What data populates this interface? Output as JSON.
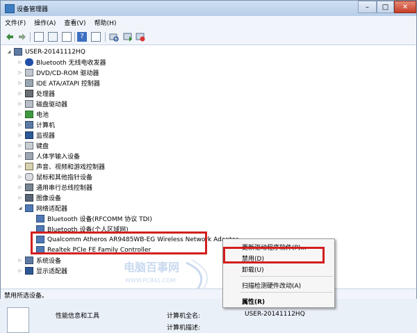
{
  "window": {
    "title": "设备管理器",
    "min": "–",
    "max": "□",
    "close": "✕"
  },
  "menu": [
    "文件(F)",
    "操作(A)",
    "查看(V)",
    "帮助(H)"
  ],
  "tree": {
    "root": "USER-20141112HQ",
    "categories": [
      "Bluetooth 无线电收发器",
      "DVD/CD-ROM 驱动器",
      "IDE ATA/ATAPI 控制器",
      "处理器",
      "磁盘驱动器",
      "电池",
      "计算机",
      "监视器",
      "键盘",
      "人体学输入设备",
      "声音、视频和游戏控制器",
      "鼠标和其他指针设备",
      "通用串行总线控制器",
      "图像设备",
      "网络适配器"
    ],
    "network_children": [
      "Bluetooth 设备(RFCOMM 协议 TDI)",
      "Bluetooth 设备(个人区域网)",
      "Qualcomm Atheros AR9485WB-EG Wireless Network Adapter",
      "Realtek PCIe FE Family Controller"
    ],
    "after": [
      "系统设备",
      "显示适配器"
    ]
  },
  "context_menu": [
    "更新驱动程序软件(P)...",
    "禁用(D)",
    "卸载(U)",
    "扫描检测硬件改动(A)",
    "属性(R)"
  ],
  "status": "禁用所选设备。",
  "bottom": {
    "perf": "性能信息和工具",
    "fullname_label": "计算机全名:",
    "fullname_value": "USER-20141112HQ",
    "desc_label": "计算机描述:"
  },
  "watermark": {
    "name": "电脑百事网",
    "url": "WWW.PC841.COM"
  },
  "colors": {
    "highlight": "#d31d1d",
    "accent": "#3e7fc4"
  }
}
